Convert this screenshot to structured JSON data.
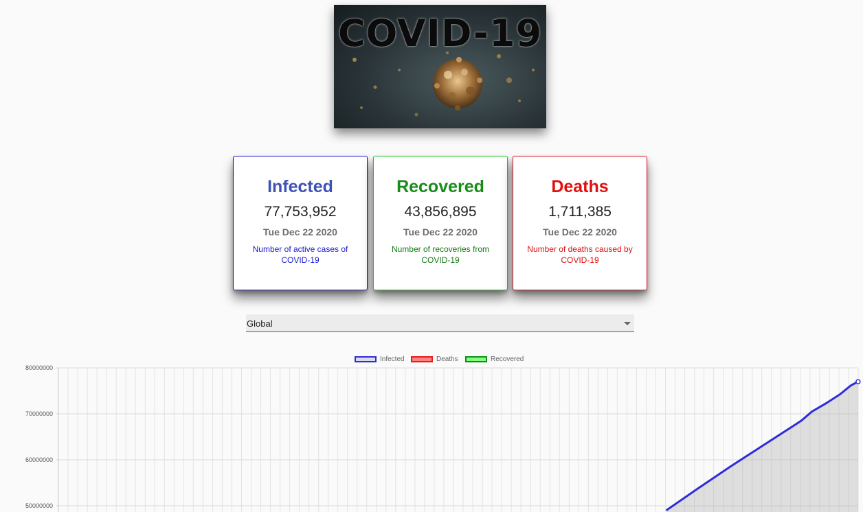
{
  "banner": {
    "title": "COVID-19",
    "alt": "virus-image"
  },
  "cards": [
    {
      "key": "infected",
      "title": "Infected",
      "value": "77,753,952",
      "date": "Tue Dec 22 2020",
      "desc": "Number of active cases of COVID-19"
    },
    {
      "key": "recovered",
      "title": "Recovered",
      "value": "43,856,895",
      "date": "Tue Dec 22 2020",
      "desc": "Number of recoveries from COVID-19"
    },
    {
      "key": "deaths",
      "title": "Deaths",
      "value": "1,711,385",
      "date": "Tue Dec 22 2020",
      "desc": "Number of deaths caused by COVID-19"
    }
  ],
  "country_select": {
    "value": "Global"
  },
  "chart_data": {
    "type": "line",
    "title": "",
    "xlabel": "",
    "ylabel": "",
    "legend_position": "top",
    "grid": true,
    "y_ticks": [
      "80000000",
      "70000000",
      "60000000",
      "50000000"
    ],
    "ylim_visible": [
      50000000,
      80000000
    ],
    "series": [
      {
        "name": "Infected",
        "color": "#2d2dd8",
        "fill": "rgba(160,160,160,0.30)",
        "visible_points": [
          [
            0.855,
            49000000
          ],
          [
            0.9,
            53800000
          ],
          [
            0.945,
            58500000
          ],
          [
            0.99,
            63000000
          ],
          [
            1.03,
            67000000
          ],
          [
            1.045,
            68500000
          ],
          [
            1.06,
            70500000
          ],
          [
            1.08,
            72300000
          ],
          [
            1.1,
            74300000
          ],
          [
            1.115,
            76200000
          ],
          [
            1.125,
            77000000
          ]
        ]
      },
      {
        "name": "Deaths",
        "color": "#e81a1a",
        "visible_points": []
      },
      {
        "name": "Recovered",
        "color": "#0f8f0f",
        "visible_points": []
      }
    ]
  },
  "colors": {
    "infected": "#3f51b5",
    "recovered": "#178c17",
    "deaths": "#e01010"
  }
}
